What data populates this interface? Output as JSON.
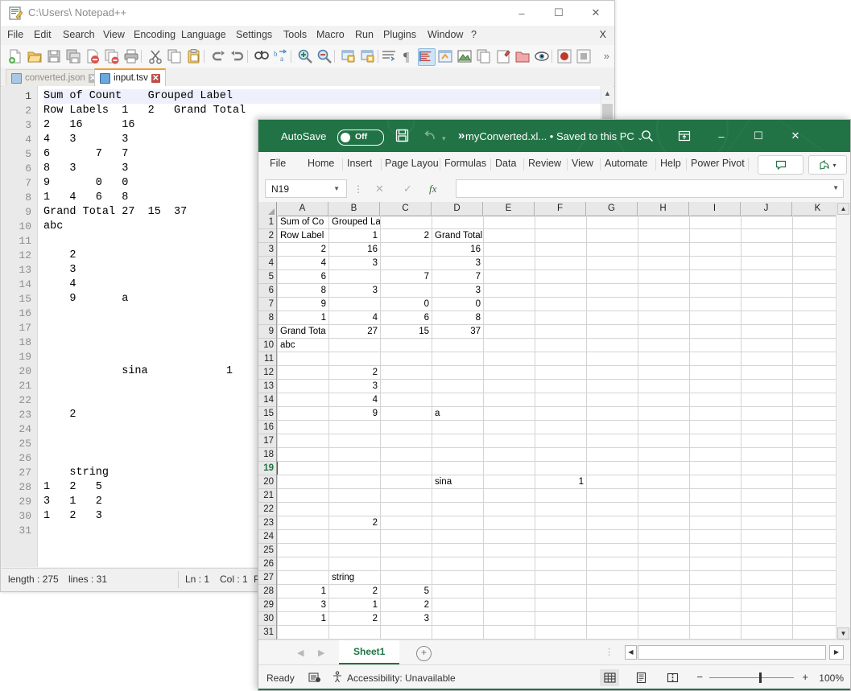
{
  "notepad": {
    "title": "C:\\Users\\ Notepad++",
    "icon": "notepad-plus-plus-icon",
    "window_buttons": {
      "minimize": "–",
      "maximize": "☐",
      "close": "✕"
    },
    "menu": [
      "File",
      "Edit",
      "Search",
      "View",
      "Encoding",
      "Language",
      "Settings",
      "Tools",
      "Macro",
      "Run",
      "Plugins",
      "Window",
      "?"
    ],
    "menu_right": "X",
    "tabs": [
      {
        "label": "converted.json",
        "active": false
      },
      {
        "label": "input.tsv",
        "active": true
      }
    ],
    "lines": [
      "Sum of Count    Grouped Label",
      "Row Labels  1   2   Grand Total",
      "2   16      16",
      "4   3       3",
      "6       7   7",
      "8   3       3",
      "9       0   0",
      "1   4   6   8",
      "Grand Total 27  15  37",
      "abc",
      "",
      "    2",
      "    3",
      "    4",
      "    9       a",
      "",
      "",
      "",
      "",
      "            sina            1",
      "",
      "",
      "    2",
      "",
      "",
      "",
      "    string",
      "1   2   5",
      "3   1   2",
      "1   2   3",
      ""
    ],
    "status": {
      "length_label": "length : 275",
      "lines_label": "lines : 31",
      "ln": "Ln : 1",
      "col": "Col : 1",
      "pos": "Po"
    }
  },
  "excel": {
    "autosave_label": "AutoSave",
    "autosave_state": "Off",
    "doc_name": "myConverted.xl... • Saved to this PC",
    "title_icons": [
      "save-icon",
      "undo-icon",
      "undo-caret-icon",
      "more-commands-icon"
    ],
    "window_buttons": {
      "search": "search-icon",
      "ribbon_display": "ribbon-display-icon",
      "minimize": "–",
      "maximize": "☐",
      "close": "✕"
    },
    "ribbon_tabs": [
      "File",
      "Home",
      "Insert",
      "Page Layou",
      "Formulas",
      "Data",
      "Review",
      "View",
      "Automate",
      "Help",
      "Power Pivot"
    ],
    "ribbon_buttons": [
      "comments-button",
      "share-button"
    ],
    "name_box": "N19",
    "formula_bar_value": "",
    "formula_icons": {
      "cancel": "✕",
      "enter": "✓",
      "insert_function": "fx"
    },
    "columns": [
      "A",
      "B",
      "C",
      "D",
      "E",
      "F",
      "G",
      "H",
      "I",
      "J",
      "K"
    ],
    "rows": [
      1,
      2,
      3,
      4,
      5,
      6,
      7,
      8,
      9,
      10,
      11,
      12,
      13,
      14,
      15,
      16,
      17,
      18,
      19,
      20,
      21,
      22,
      23,
      24,
      25,
      26,
      27,
      28,
      29,
      30,
      31
    ],
    "selected_cell": "N19",
    "selected_row": 19,
    "cells": [
      {
        "row": 1,
        "col": "A",
        "value": "Sum of Co",
        "align": "l"
      },
      {
        "row": 1,
        "col": "B",
        "value": "Grouped Label",
        "align": "l"
      },
      {
        "row": 2,
        "col": "A",
        "value": "Row Label",
        "align": "l"
      },
      {
        "row": 2,
        "col": "B",
        "value": "1",
        "align": "r"
      },
      {
        "row": 2,
        "col": "C",
        "value": "2",
        "align": "r"
      },
      {
        "row": 2,
        "col": "D",
        "value": "Grand Total",
        "align": "l"
      },
      {
        "row": 3,
        "col": "A",
        "value": "2",
        "align": "r"
      },
      {
        "row": 3,
        "col": "B",
        "value": "16",
        "align": "r"
      },
      {
        "row": 3,
        "col": "D",
        "value": "16",
        "align": "r"
      },
      {
        "row": 4,
        "col": "A",
        "value": "4",
        "align": "r"
      },
      {
        "row": 4,
        "col": "B",
        "value": "3",
        "align": "r"
      },
      {
        "row": 4,
        "col": "D",
        "value": "3",
        "align": "r"
      },
      {
        "row": 5,
        "col": "A",
        "value": "6",
        "align": "r"
      },
      {
        "row": 5,
        "col": "C",
        "value": "7",
        "align": "r"
      },
      {
        "row": 5,
        "col": "D",
        "value": "7",
        "align": "r"
      },
      {
        "row": 6,
        "col": "A",
        "value": "8",
        "align": "r"
      },
      {
        "row": 6,
        "col": "B",
        "value": "3",
        "align": "r"
      },
      {
        "row": 6,
        "col": "D",
        "value": "3",
        "align": "r"
      },
      {
        "row": 7,
        "col": "A",
        "value": "9",
        "align": "r"
      },
      {
        "row": 7,
        "col": "C",
        "value": "0",
        "align": "r"
      },
      {
        "row": 7,
        "col": "D",
        "value": "0",
        "align": "r"
      },
      {
        "row": 8,
        "col": "A",
        "value": "1",
        "align": "r"
      },
      {
        "row": 8,
        "col": "B",
        "value": "4",
        "align": "r"
      },
      {
        "row": 8,
        "col": "C",
        "value": "6",
        "align": "r"
      },
      {
        "row": 8,
        "col": "D",
        "value": "8",
        "align": "r"
      },
      {
        "row": 9,
        "col": "A",
        "value": "Grand Tota",
        "align": "l"
      },
      {
        "row": 9,
        "col": "B",
        "value": "27",
        "align": "r"
      },
      {
        "row": 9,
        "col": "C",
        "value": "15",
        "align": "r"
      },
      {
        "row": 9,
        "col": "D",
        "value": "37",
        "align": "r"
      },
      {
        "row": 10,
        "col": "A",
        "value": "abc",
        "align": "l"
      },
      {
        "row": 12,
        "col": "B",
        "value": "2",
        "align": "r"
      },
      {
        "row": 13,
        "col": "B",
        "value": "3",
        "align": "r"
      },
      {
        "row": 14,
        "col": "B",
        "value": "4",
        "align": "r"
      },
      {
        "row": 15,
        "col": "B",
        "value": "9",
        "align": "r"
      },
      {
        "row": 15,
        "col": "D",
        "value": "a",
        "align": "l"
      },
      {
        "row": 20,
        "col": "D",
        "value": "sina",
        "align": "l"
      },
      {
        "row": 20,
        "col": "F",
        "value": "1",
        "align": "r"
      },
      {
        "row": 23,
        "col": "B",
        "value": "2",
        "align": "r"
      },
      {
        "row": 27,
        "col": "B",
        "value": "string",
        "align": "l"
      },
      {
        "row": 28,
        "col": "A",
        "value": "1",
        "align": "r"
      },
      {
        "row": 28,
        "col": "B",
        "value": "2",
        "align": "r"
      },
      {
        "row": 28,
        "col": "C",
        "value": "5",
        "align": "r"
      },
      {
        "row": 29,
        "col": "A",
        "value": "3",
        "align": "r"
      },
      {
        "row": 29,
        "col": "B",
        "value": "1",
        "align": "r"
      },
      {
        "row": 29,
        "col": "C",
        "value": "2",
        "align": "r"
      },
      {
        "row": 30,
        "col": "A",
        "value": "1",
        "align": "r"
      },
      {
        "row": 30,
        "col": "B",
        "value": "2",
        "align": "r"
      },
      {
        "row": 30,
        "col": "C",
        "value": "3",
        "align": "r"
      }
    ],
    "sheet_tabs": [
      "Sheet1"
    ],
    "add_sheet_label": "+",
    "status": {
      "ready": "Ready",
      "accessibility": "Accessibility: Unavailable",
      "zoom": "100%"
    },
    "accent_color": "#217346"
  }
}
